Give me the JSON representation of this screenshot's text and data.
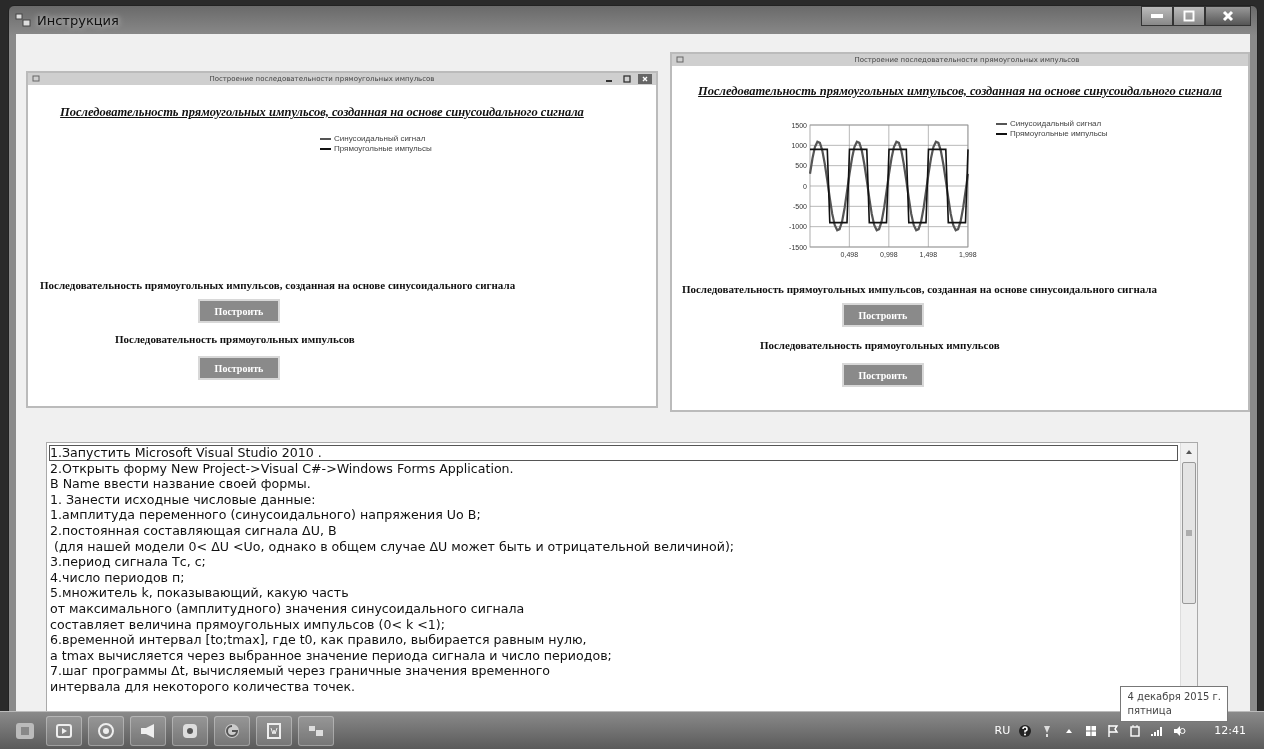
{
  "window": {
    "title": "Инструкция"
  },
  "forms": [
    {
      "title": "Построение последовательности прямоугольных импульсов",
      "controls": true,
      "heading": "Последовательность прямоугольных импульсов, созданная на основе синусоидального сигнала",
      "legend": [
        {
          "name": "Синусоидальный сигнал",
          "color": "#555555"
        },
        {
          "name": "Прямоугольные импульсы",
          "color": "#111111"
        }
      ],
      "sections": [
        {
          "label": "Последовательность прямоугольных импульсов, созданная на основе синусоидального сигнала",
          "button": "Построить"
        },
        {
          "label": "Последовательность прямоугольных импульсов",
          "button": "Построить"
        }
      ]
    },
    {
      "title": "Построение последовательности прямоугольных импульсов",
      "controls": false,
      "heading": "Последовательность прямоугольных импульсов, созданная на основе синусоидального сигнала",
      "chart_data": {
        "type": "line",
        "grid": true,
        "xlim": [
          0,
          2
        ],
        "ylim": [
          -1500,
          1500
        ],
        "yticks": [
          -1500,
          -1000,
          -500,
          0,
          500,
          1000,
          1500
        ],
        "xticks": [
          {
            "value": 0.498,
            "label": "0,498"
          },
          {
            "value": 0.998,
            "label": "0,998"
          },
          {
            "value": 1.498,
            "label": "1,498"
          },
          {
            "value": 1.998,
            "label": "1,998"
          }
        ],
        "x": [
          0,
          0.03125,
          0.0625,
          0.09375,
          0.125,
          0.15625,
          0.1875,
          0.21875,
          0.25,
          0.28125,
          0.3125,
          0.34375,
          0.375,
          0.40625,
          0.4375,
          0.46875,
          0.5,
          0.53125,
          0.5625,
          0.59375,
          0.625,
          0.65625,
          0.6875,
          0.71875,
          0.75,
          0.78125,
          0.8125,
          0.84375,
          0.875,
          0.90625,
          0.9375,
          0.96875,
          1,
          1.03125,
          1.0625,
          1.09375,
          1.125,
          1.15625,
          1.1875,
          1.21875,
          1.25,
          1.28125,
          1.3125,
          1.34375,
          1.375,
          1.40625,
          1.4375,
          1.46875,
          1.5,
          1.53125,
          1.5625,
          1.59375,
          1.625,
          1.65625,
          1.6875,
          1.71875,
          1.75,
          1.78125,
          1.8125,
          1.84375,
          1.875,
          1.90625,
          1.9375,
          1.96875,
          2
        ],
        "series": [
          {
            "name": "Синусоидальный сигнал",
            "color": "#555555",
            "values": [
              300,
              680,
              960,
              1090,
              1060,
              870,
              540,
              130,
              -300,
              -680,
              -960,
              -1090,
              -1060,
              -870,
              -540,
              -130,
              300,
              680,
              960,
              1090,
              1060,
              870,
              540,
              130,
              -300,
              -680,
              -960,
              -1090,
              -1060,
              -870,
              -540,
              -130,
              300,
              680,
              960,
              1090,
              1060,
              870,
              540,
              130,
              -300,
              -680,
              -960,
              -1090,
              -1060,
              -870,
              -540,
              -130,
              300,
              680,
              960,
              1090,
              1060,
              870,
              540,
              130,
              -300,
              -680,
              -960,
              -1090,
              -1060,
              -870,
              -540,
              -130,
              300
            ]
          },
          {
            "name": "Прямоугольные импульсы",
            "color": "#111111",
            "values": [
              900,
              900,
              900,
              900,
              900,
              900,
              900,
              900,
              -900,
              -900,
              -900,
              -900,
              -900,
              -900,
              -900,
              -900,
              900,
              900,
              900,
              900,
              900,
              900,
              900,
              900,
              -900,
              -900,
              -900,
              -900,
              -900,
              -900,
              -900,
              -900,
              900,
              900,
              900,
              900,
              900,
              900,
              900,
              900,
              -900,
              -900,
              -900,
              -900,
              -900,
              -900,
              -900,
              -900,
              900,
              900,
              900,
              900,
              900,
              900,
              900,
              900,
              -900,
              -900,
              -900,
              -900,
              -900,
              -900,
              -900,
              -900,
              900
            ]
          }
        ]
      },
      "sections": [
        {
          "label": "Последовательность прямоугольных импульсов, созданная на основе синусоидального сигнала",
          "button": "Построить"
        },
        {
          "label": "Последовательность прямоугольных импульсов",
          "button": "Построить"
        }
      ]
    }
  ],
  "instructions": [
    {
      "text": "1.Запустить Microsoft Visual Studio 2010 .",
      "focused": true
    },
    {
      "text": "2.Открыть форму New Project->Visual C#->Windows Forms Application.",
      "focused": false
    },
    {
      "text": "В Name ввести название своей формы.",
      "focused": false
    },
    {
      "text": "1. Занести исходные числовые данные:",
      "focused": false
    },
    {
      "text": "1.амплитуда переменного (синусоидального) напряжения Uo В;",
      "focused": false
    },
    {
      "text": "2.постоянная составляющая сигнала ΔU, В",
      "focused": false
    },
    {
      "text": " (для нашей модели 0< ΔU <Uo, однако в общем случае ΔU может быть и отрицательной величиной);",
      "focused": false
    },
    {
      "text": "3.период сигнала Тс, с;",
      "focused": false
    },
    {
      "text": "4.число периодов п;",
      "focused": false
    },
    {
      "text": "5.множитель k, показывающий, какую часть",
      "focused": false
    },
    {
      "text": "от максимального (амплитудного) значения синусоидального сигнала",
      "focused": false
    },
    {
      "text": "составляет величина прямоугольных импульсов (0< k <1);",
      "focused": false
    },
    {
      "text": "6.временной интервал [to;tmax], где t0, как правило, выбирается равным нулю,",
      "focused": false
    },
    {
      "text": "а tmax вычисляется через выбранное значение периода сигнала и число периодов;",
      "focused": false
    },
    {
      "text": "7.шаг программы Δt, вычисляемый через граничные значения временного",
      "focused": false
    },
    {
      "text": "интервала для некоторого количества точек.",
      "focused": false
    }
  ],
  "tooltip": {
    "lines": [
      "4 декабря 2015 г.",
      "пятница"
    ]
  },
  "tray": {
    "language": "RU",
    "time": "12:41"
  }
}
